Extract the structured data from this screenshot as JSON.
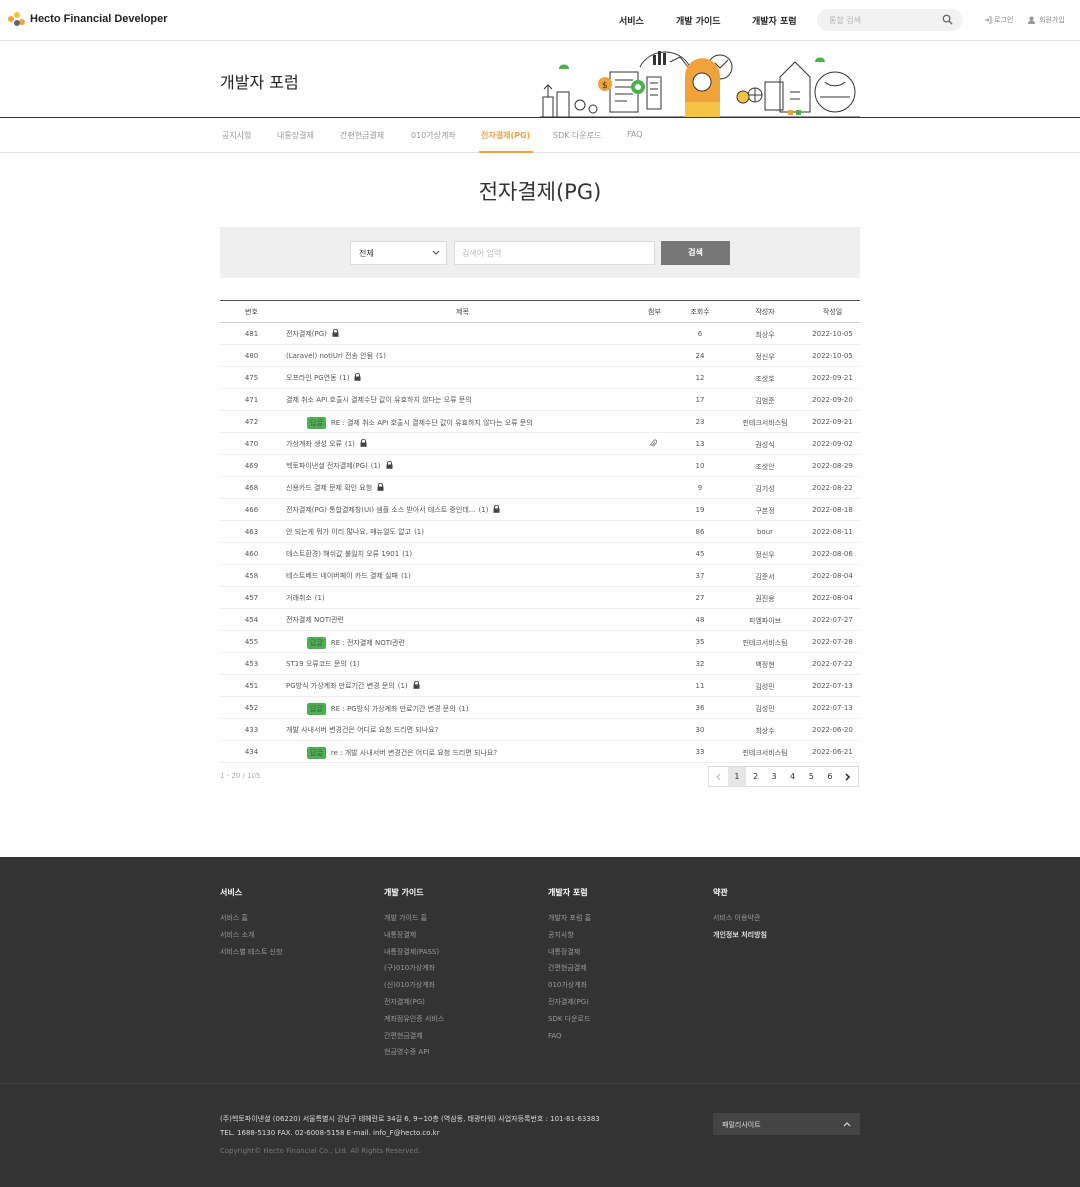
{
  "header": {
    "brand": "Hecto Financial Developer",
    "nav": [
      "서비스",
      "개발 가이드",
      "개발자 포럼"
    ],
    "search_placeholder": "통합 검색",
    "login": "로그인",
    "signup": "회원가입"
  },
  "hero": {
    "title": "개발자 포럼"
  },
  "subnav": {
    "items": [
      "공지사항",
      "내통장결제",
      "간편현금결제",
      "010가상계좌",
      "전자결제(PG)",
      "SDK 다운로드",
      "FAQ"
    ],
    "active": "전자결제(PG)"
  },
  "page": {
    "title": "전자결제(PG)"
  },
  "filter": {
    "select_value": "전체",
    "keyword_placeholder": "검색어 입력",
    "search_button": "검색"
  },
  "table": {
    "headers": [
      "번호",
      "제목",
      "첨부",
      "조회수",
      "작성자",
      "작성일"
    ],
    "reply_badge": "답글",
    "rows": [
      {
        "no": "481",
        "title": "전자결제(PG)",
        "comments": "",
        "lock": true,
        "reply": false,
        "attach": false,
        "views": "6",
        "author": "최상우",
        "date": "2022-10-05"
      },
      {
        "no": "480",
        "title": "(Laravel) notiUrl 전송 안됨",
        "comments": "(1)",
        "lock": false,
        "reply": false,
        "attach": false,
        "views": "24",
        "author": "정신우",
        "date": "2022-10-05"
      },
      {
        "no": "475",
        "title": "오프라인 PG연동",
        "comments": "(1)",
        "lock": true,
        "reply": false,
        "attach": false,
        "views": "12",
        "author": "조성호",
        "date": "2022-09-21"
      },
      {
        "no": "471",
        "title": "결제 취소 API 호출시 결제수단 값이 유효하지 않다는 오류 문의",
        "comments": "",
        "lock": false,
        "reply": false,
        "attach": false,
        "views": "17",
        "author": "김범준",
        "date": "2022-09-20"
      },
      {
        "no": "472",
        "title": "RE : 결제 취소 API 호출시 결제수단 값이 유효하지 않다는 오류 문의",
        "comments": "",
        "lock": false,
        "reply": true,
        "attach": false,
        "views": "23",
        "author": "핀테크서비스팀",
        "date": "2022-09-21"
      },
      {
        "no": "470",
        "title": "가상계좌 생성 오류",
        "comments": "(1)",
        "lock": true,
        "reply": false,
        "attach": true,
        "views": "13",
        "author": "권성식",
        "date": "2022-09-02"
      },
      {
        "no": "469",
        "title": "헥토파이낸셜 전자결제(PG)",
        "comments": "(1)",
        "lock": true,
        "reply": false,
        "attach": false,
        "views": "10",
        "author": "조성안",
        "date": "2022-08-29"
      },
      {
        "no": "468",
        "title": "신용카드 결제 문제 확인 요청",
        "comments": "",
        "lock": true,
        "reply": false,
        "attach": false,
        "views": "9",
        "author": "김기성",
        "date": "2022-08-22"
      },
      {
        "no": "466",
        "title": "전자결제(PG) 통합결제창(UI) 샘플 소스 받아서 테스트 중인데...",
        "comments": "(1)",
        "lock": true,
        "reply": false,
        "attach": false,
        "views": "19",
        "author": "구본정",
        "date": "2022-08-18"
      },
      {
        "no": "463",
        "title": "안 되는게 뭐가 이리 많나요, 매뉴얼도 없고",
        "comments": "(1)",
        "lock": false,
        "reply": false,
        "attach": false,
        "views": "86",
        "author": "bour",
        "date": "2022-08-11"
      },
      {
        "no": "460",
        "title": "테스트환경) 해쉬값 불일치 오류 1901",
        "comments": "(1)",
        "lock": false,
        "reply": false,
        "attach": false,
        "views": "45",
        "author": "정신우",
        "date": "2022-08-06"
      },
      {
        "no": "458",
        "title": "테스트베드 네이버페이 카드 결제 실패",
        "comments": "(1)",
        "lock": false,
        "reply": false,
        "attach": false,
        "views": "37",
        "author": "김준서",
        "date": "2022-08-04"
      },
      {
        "no": "457",
        "title": "거래취소",
        "comments": "(1)",
        "lock": false,
        "reply": false,
        "attach": false,
        "views": "27",
        "author": "권진용",
        "date": "2022-08-04"
      },
      {
        "no": "454",
        "title": "전자결제 NOTI관련",
        "comments": "",
        "lock": false,
        "reply": false,
        "attach": false,
        "views": "48",
        "author": "피엠파이브",
        "date": "2022-07-27"
      },
      {
        "no": "455",
        "title": "RE : 전자결제 NOTI관련",
        "comments": "",
        "lock": false,
        "reply": true,
        "attach": false,
        "views": "35",
        "author": "핀테크서비스팀",
        "date": "2022-07-28"
      },
      {
        "no": "453",
        "title": "ST19 오류코드 문의",
        "comments": "(1)",
        "lock": false,
        "reply": false,
        "attach": false,
        "views": "32",
        "author": "백정현",
        "date": "2022-07-22"
      },
      {
        "no": "451",
        "title": "PG방식 가상계좌 만료기간 변경 문의",
        "comments": "(1)",
        "lock": true,
        "reply": false,
        "attach": false,
        "views": "11",
        "author": "김성민",
        "date": "2022-07-13"
      },
      {
        "no": "452",
        "title": "RE : PG방식 가상계좌 만료기간 변경 문의",
        "comments": "(1)",
        "lock": false,
        "reply": true,
        "attach": false,
        "views": "36",
        "author": "김성민",
        "date": "2022-07-13"
      },
      {
        "no": "433",
        "title": "개발 사내서버 변경건은 어디로 요청 드리면 되나요?",
        "comments": "",
        "lock": false,
        "reply": false,
        "attach": false,
        "views": "30",
        "author": "최상수",
        "date": "2022-06-20"
      },
      {
        "no": "434",
        "title": "re : 개발 사내서버 변경건은 어디로 요청 드리면 되나요?",
        "comments": "",
        "lock": false,
        "reply": true,
        "attach": false,
        "views": "33",
        "author": "핀테크서비스팀",
        "date": "2022-06-21"
      }
    ]
  },
  "pagination": {
    "count_text": "1 - 20 / 105",
    "pages": [
      "1",
      "2",
      "3",
      "4",
      "5",
      "6"
    ],
    "current": "1"
  },
  "footer": {
    "columns": [
      {
        "title": "서비스",
        "links": [
          "서비스 홈",
          "서비스 소개",
          "서비스별 테스트 신청"
        ]
      },
      {
        "title": "개발 가이드",
        "links": [
          "개발 가이드 홈",
          "내통장결제",
          "내통장결제(PASS)",
          "(구)010가상계좌",
          "(신)010가상계좌",
          "전자결제(PG)",
          "계좌점유인증 서비스",
          "간편현금결제",
          "현금영수증 API"
        ]
      },
      {
        "title": "개발자 포럼",
        "links": [
          "개발자 포럼 홈",
          "공지사항",
          "내통장결제",
          "간편현금결제",
          "010가상계좌",
          "전자결제(PG)",
          "SDK 다운로드",
          "FAQ"
        ]
      },
      {
        "title": "약관",
        "links": [
          "서비스 이용약관",
          "개인정보 처리방침"
        ]
      }
    ],
    "company_line": "(주)헥토파이낸셜     (06220) 서울특별시 강남구 테헤란로 34길 6, 9~10층 (역삼동, 태광타워)     사업자등록번호 : 101-81-63383",
    "contact_line": "TEL. 1688-5130     FAX. 02-6008-5158     E-mail. info_F@hecto.co.kr",
    "copyright": "Copyright© Hecto Financial Co., Ltd. All Rights Reserved.",
    "family_site": "패밀리사이트"
  },
  "colors": {
    "accent": "#f0a33a",
    "reply_badge": "#4caf50",
    "footer_bg": "#333333"
  }
}
